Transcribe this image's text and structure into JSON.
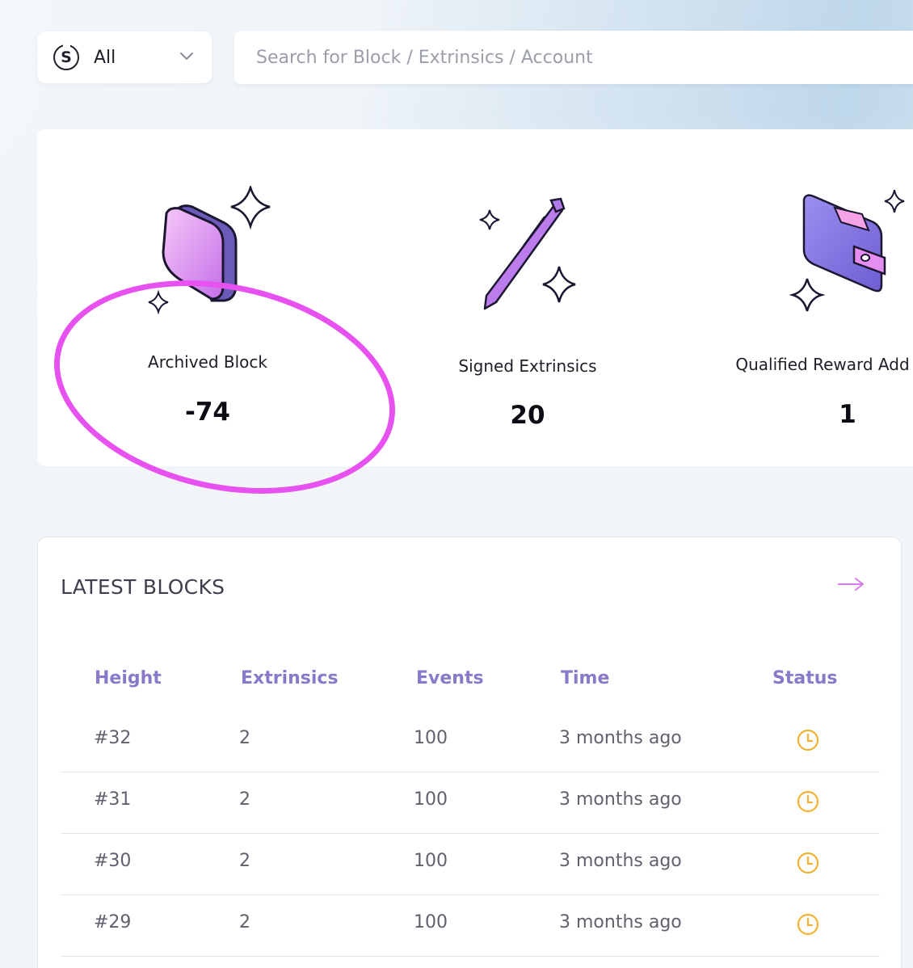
{
  "network_selector": {
    "logo_letter": "S",
    "selected": "All",
    "icon": "chevron-down-icon"
  },
  "search": {
    "placeholder": "Search for Block / Extrinsics / Account",
    "value": ""
  },
  "stats": [
    {
      "label": "Archived Block",
      "value": "-74",
      "icon": "archive-block-icon"
    },
    {
      "label": "Signed Extrinsics",
      "value": "20",
      "icon": "pen-icon"
    },
    {
      "label": "Qualified Reward Add",
      "value": "1",
      "icon": "wallet-icon"
    }
  ],
  "latest_blocks": {
    "title": "LATEST BLOCKS",
    "more_icon": "arrow-right-icon",
    "columns": [
      "Height",
      "Extrinsics",
      "Events",
      "Time",
      "Status"
    ],
    "rows": [
      {
        "height": "#32",
        "extrinsics": "2",
        "events": "100",
        "time": "3 months ago",
        "status": "clock-icon"
      },
      {
        "height": "#31",
        "extrinsics": "2",
        "events": "100",
        "time": "3 months ago",
        "status": "clock-icon"
      },
      {
        "height": "#30",
        "extrinsics": "2",
        "events": "100",
        "time": "3 months ago",
        "status": "clock-icon"
      },
      {
        "height": "#29",
        "extrinsics": "2",
        "events": "100",
        "time": "3 months ago",
        "status": "clock-icon"
      }
    ]
  },
  "colors": {
    "accent": "#e651f0",
    "header_text": "#8a78c8",
    "status_pending": "#f2b233"
  }
}
